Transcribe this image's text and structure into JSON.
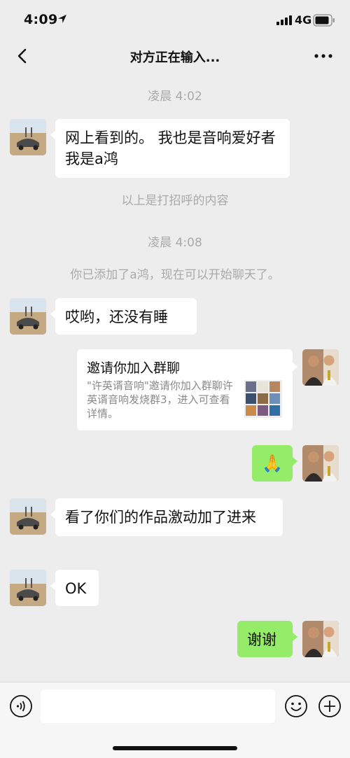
{
  "status_bar": {
    "time": "4:09",
    "network": "4G"
  },
  "nav": {
    "title": "对方正在输入..."
  },
  "timestamps": {
    "first": "凌晨 4:02",
    "second": "凌晨 4:08"
  },
  "system_notes": {
    "greeting_note": "以上是打招呼的内容",
    "added_note": "你已添加了a鸿，现在可以开始聊天了。"
  },
  "messages": [
    {
      "text": "网上看到的。 我也是音响爱好者 我是a鸿"
    },
    {
      "text": "哎哟，还没有睡"
    },
    {
      "text": ""
    },
    {
      "text": ""
    },
    {
      "text": "看了你们的作品激动加了进来"
    },
    {
      "text": "OK"
    },
    {
      "text": "谢谢"
    }
  ],
  "invite_card": {
    "title": "邀请你加入群聊",
    "description": "\"许英谞音响\"邀请你加入群聊许英谞音响发烧群3，进入可查看详情。"
  },
  "clap_emoji": "🙏",
  "input": {
    "placeholder": ""
  },
  "colors": {
    "background": "#ededed",
    "sent_bubble": "#95ec69",
    "received_bubble": "#ffffff"
  }
}
